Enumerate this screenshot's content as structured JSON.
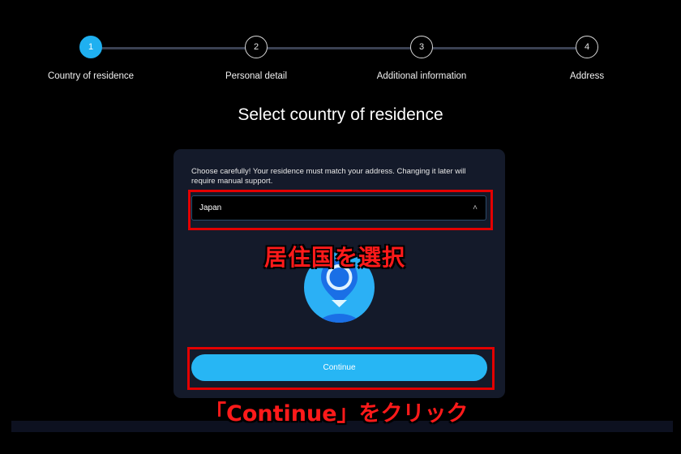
{
  "stepper": {
    "steps": [
      {
        "number": "1",
        "label": "Country of residence",
        "active": true
      },
      {
        "number": "2",
        "label": "Personal detail",
        "active": false
      },
      {
        "number": "3",
        "label": "Additional information",
        "active": false
      },
      {
        "number": "4",
        "label": "Address",
        "active": false
      }
    ]
  },
  "page": {
    "title": "Select country of residence"
  },
  "card": {
    "notice": "Choose carefully! Your residence must match your address. Changing it later will require manual support.",
    "country_select": {
      "value": "Japan",
      "icon": "chevron-up-icon"
    },
    "illustration_icon": "location-pin-icon",
    "continue_label": "Continue"
  },
  "annotations": {
    "select_hint": "居住国を選択",
    "continue_hint": "「Continue」をクリック"
  },
  "colors": {
    "accent": "#1fb0f0",
    "card_bg": "#141a2a",
    "highlight": "#e30000"
  }
}
